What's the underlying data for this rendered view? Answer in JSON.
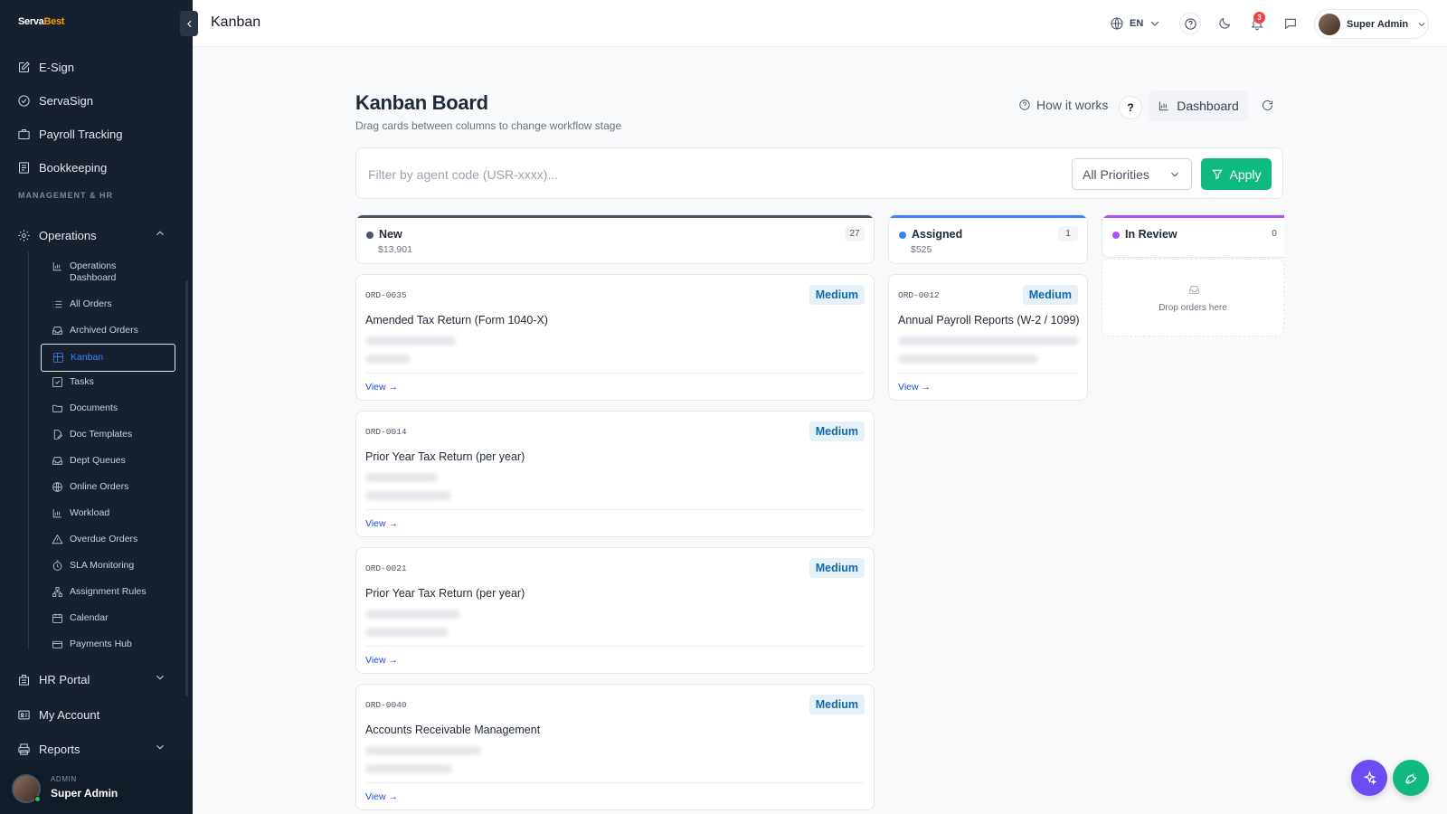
{
  "app": {
    "logo_text_a": "Serva",
    "logo_text_b": "Best"
  },
  "topbar": {
    "title": "Kanban",
    "language": "EN",
    "notification_count": "3",
    "user_name": "Super Admin"
  },
  "sidebar": {
    "top_items": [
      {
        "label": "E-Sign",
        "icon": "pen-square-icon"
      },
      {
        "label": "ServaSign",
        "icon": "check-circle-icon"
      },
      {
        "label": "Payroll Tracking",
        "icon": "briefcase-icon"
      },
      {
        "label": "Bookkeeping",
        "icon": "book-icon"
      }
    ],
    "section_label": "MANAGEMENT & HR",
    "operations_label": "Operations",
    "sub_items": [
      {
        "label": "Operations Dashboard",
        "line1": "Operations",
        "line2": "Dashboard",
        "icon": "bar-chart-icon"
      },
      {
        "label": "All Orders",
        "icon": "list-icon"
      },
      {
        "label": "Archived Orders",
        "icon": "inbox-icon"
      },
      {
        "label": "Kanban",
        "icon": "kanban-icon"
      },
      {
        "label": "Tasks",
        "icon": "checkbox-icon"
      },
      {
        "label": "Documents",
        "icon": "folder-icon"
      },
      {
        "label": "Doc Templates",
        "icon": "file-edit-icon"
      },
      {
        "label": "Dept Queues",
        "icon": "inbox-icon"
      },
      {
        "label": "Online Orders",
        "icon": "globe-icon"
      },
      {
        "label": "Workload",
        "icon": "bar-chart-icon"
      },
      {
        "label": "Overdue Orders",
        "icon": "warning-icon"
      },
      {
        "label": "SLA Monitoring",
        "icon": "timer-icon"
      },
      {
        "label": "Assignment Rules",
        "icon": "network-icon"
      },
      {
        "label": "Calendar",
        "icon": "calendar-icon"
      },
      {
        "label": "Payments Hub",
        "icon": "credit-card-icon"
      }
    ],
    "bottom_items": [
      {
        "label": "HR Portal",
        "icon": "building-icon"
      },
      {
        "label": "My Account",
        "icon": "id-card-icon"
      },
      {
        "label": "Reports",
        "icon": "printer-icon"
      }
    ],
    "footer": {
      "role": "ADMIN",
      "name": "Super Admin"
    }
  },
  "board": {
    "title": "Kanban Board",
    "subtitle": "Drag cards between columns to change workflow stage",
    "how_it_works": "How it works",
    "help_label": "?",
    "dashboard_label": "Dashboard"
  },
  "filter": {
    "placeholder": "Filter by agent code (USR-xxxx)...",
    "value": "",
    "priority_selected": "All Priorities",
    "apply_label": "Apply"
  },
  "columns": [
    {
      "name": "New",
      "amount": "$13,901",
      "count": "27",
      "color": "#4b5563"
    },
    {
      "name": "Assigned",
      "amount": "$525",
      "count": "1",
      "color": "#3b82f6"
    },
    {
      "name": "In Review",
      "amount": "",
      "count": "0",
      "color": "#a855f7"
    }
  ],
  "cards": [
    {
      "column": "New",
      "order": "ORD-0035",
      "priority": "Medium",
      "title": "Amended Tax Return (Form 1040-X)",
      "view": "View →"
    },
    {
      "column": "New",
      "order": "ORD-0014",
      "priority": "Medium",
      "title": "Prior Year Tax Return (per year)",
      "view": "View →"
    },
    {
      "column": "New",
      "order": "ORD-0021",
      "priority": "Medium",
      "title": "Prior Year Tax Return (per year)",
      "view": "View →"
    },
    {
      "column": "New",
      "order": "ORD-0040",
      "priority": "Medium",
      "title": "Accounts Receivable Management",
      "view": "View →"
    },
    {
      "column": "Assigned",
      "order": "ORD-0012",
      "priority": "Medium",
      "title": "Annual Payroll Reports (W-2 / 1099)",
      "view": "View →"
    }
  ],
  "drop_zone": {
    "text": "Drop orders here"
  },
  "colors": {
    "sidebar_bg": "#16202f",
    "accent_green": "#10b981",
    "accent_purple": "#6d4df2",
    "priority_text": "#0e6aa8",
    "notification_red": "#ef4444"
  }
}
